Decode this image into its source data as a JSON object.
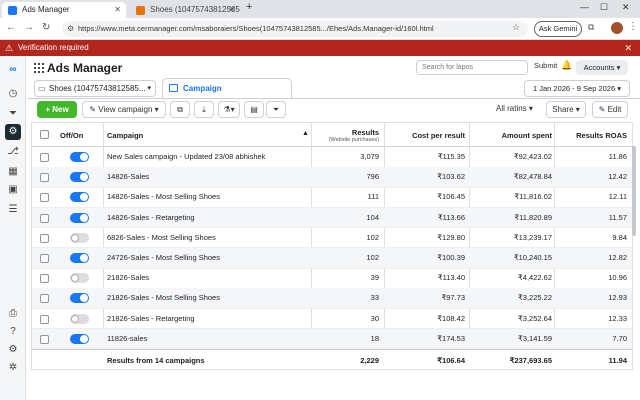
{
  "browser": {
    "tabs": [
      {
        "label": "Ads Manager",
        "favicon_color": "#1877f2"
      },
      {
        "label": "Shoes (10475743812585... ",
        "favicon_color": "#e8710a"
      }
    ],
    "url": "https://www.meta.cermanager.com/msaboraiers/Shoes(10475743812585.../Ehes/Ads.Manager-id/160l.html",
    "gemini_label": "Ask Gemini"
  },
  "banner": {
    "text": "Verification required",
    "color": "#b3261e"
  },
  "header": {
    "title": "Ads Manager",
    "search_placeholder": "Search for lapos",
    "submit_label": "Submit",
    "accounts_label": "Accounts",
    "account_selector": "Shoes (10475743812585...",
    "campaign_tab": "Campaign",
    "date_range": "1 Jan 2026 - 9 Sep 2026"
  },
  "toolbar": {
    "new_label": "New",
    "view_campaign_label": "View campaign",
    "all_ratings_label": "All ratins",
    "share_label": "Share",
    "edit_label": "Edit"
  },
  "table": {
    "columns": {
      "offon": "Off/On",
      "campaign": "Campaign",
      "results": "Results",
      "results_sub": "(Website purchases)",
      "cpr": "Cost per result",
      "spent": "Amount spent",
      "roas": "Results ROAS"
    },
    "rows": [
      {
        "on": true,
        "campaign": "New Sales campaign - Updated 23/08 abhishek",
        "results": "3,079",
        "cpr": "₹115.35",
        "spent": "₹92,423.02",
        "roas": "11.86"
      },
      {
        "on": true,
        "campaign": "14826-Sales",
        "results": "796",
        "cpr": "₹103.62",
        "spent": "₹82,478.84",
        "roas": "12.42"
      },
      {
        "on": true,
        "campaign": "14826-Sales - Most Selling Shoes",
        "results": "111",
        "cpr": "₹106.45",
        "spent": "₹11,816.02",
        "roas": "12.11"
      },
      {
        "on": true,
        "campaign": "14826-Sales - Retargeting",
        "results": "104",
        "cpr": "₹113.66",
        "spent": "₹11,820.89",
        "roas": "11.57"
      },
      {
        "on": false,
        "campaign": "6826-Sales - Most Selling Shoes",
        "results": "102",
        "cpr": "₹129.80",
        "spent": "₹13,239.17",
        "roas": "9.84"
      },
      {
        "on": true,
        "campaign": "24726-Sales - Most Selling Shoes",
        "results": "102",
        "cpr": "₹100.39",
        "spent": "₹10,240.15",
        "roas": "12.82"
      },
      {
        "on": false,
        "campaign": "21826-Sales",
        "results": "39",
        "cpr": "₹113.40",
        "spent": "₹4,422.62",
        "roas": "10.96"
      },
      {
        "on": true,
        "campaign": "21826-Sales - Most Selling Shoes",
        "results": "33",
        "cpr": "₹97.73",
        "spent": "₹3,225.22",
        "roas": "12.93"
      },
      {
        "on": false,
        "campaign": "21826-Sales - Retargeting",
        "results": "30",
        "cpr": "₹108.42",
        "spent": "₹3,252.64",
        "roas": "12.33"
      },
      {
        "on": true,
        "campaign": "11826-sales",
        "results": "18",
        "cpr": "₹174.53",
        "spent": "₹3,141.59",
        "roas": "7.70"
      }
    ],
    "totals": {
      "label": "Results from 14 campaigns",
      "results": "2,229",
      "cpr": "₹106.64",
      "spent": "₹237,693.65",
      "roas": "11.94"
    }
  },
  "colors": {
    "accent": "#1877f2",
    "new_button": "#42b72a"
  }
}
